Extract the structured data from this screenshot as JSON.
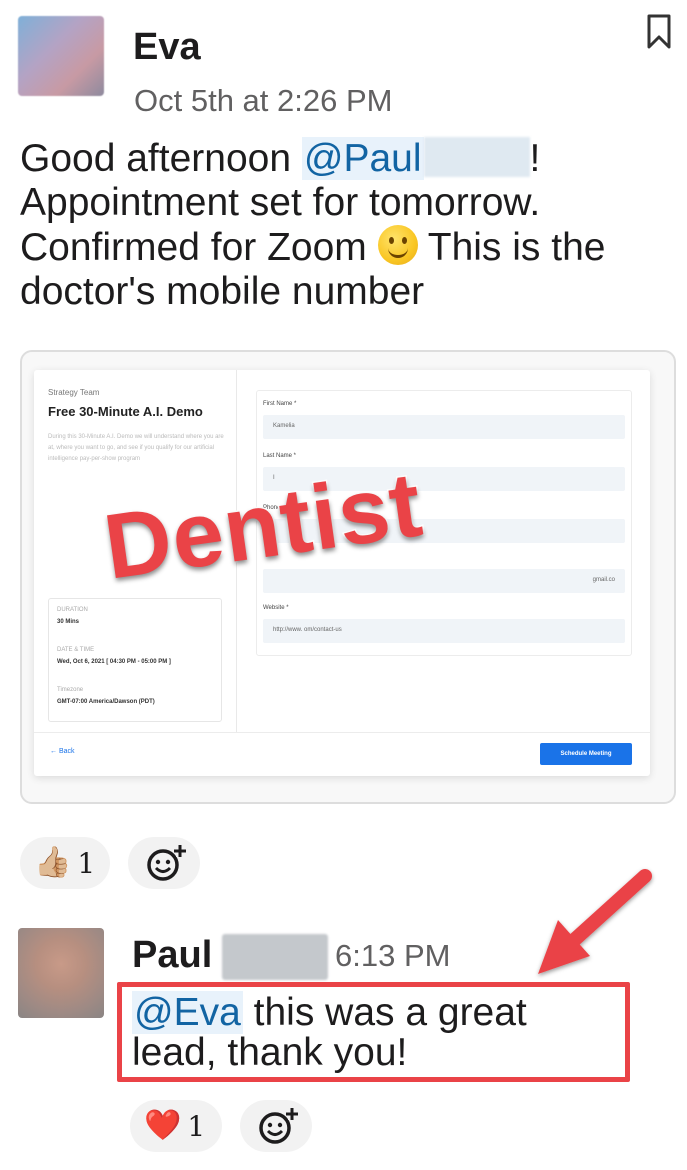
{
  "messages": [
    {
      "author": "Eva",
      "timestamp": "Oct 5th at 2:26 PM",
      "text_intro": "Good afternoon ",
      "mention": "@Paul",
      "text_after_mention": "!",
      "text_body": "Appointment set for tomorrow. Confirmed for Zoom",
      "text_tail": " This is the doctor's mobile number",
      "emoji": "slightly-smiling-face",
      "attachment": {
        "team": "Strategy Team",
        "title": "Free 30-Minute A.I. Demo",
        "description": "During this 30-Minute A.I. Demo we will understand where you are at, where you want to go, and see if you qualify for our artificial intelligence pay-per-show program",
        "duration_label": "DURATION",
        "duration_value": "30 Mins",
        "datetime_label": "DATE & TIME",
        "datetime_value": "Wed, Oct 6, 2021 [ 04:30 PM - 05:00 PM ]",
        "timezone_label": "Timezone",
        "timezone_value": "GMT-07:00 America/Dawson (PDT)",
        "form": {
          "first_name_label": "First Name *",
          "first_name_value": "Kamelia",
          "last_name_label": "Last Name *",
          "last_name_value": "I",
          "phone_label": "Phone *",
          "email_value": "gmail.co",
          "website_label": "Website *",
          "website_value": "http://www.                     om/contact-us"
        },
        "back_label": "← Back",
        "button_label": "Schedule Meeting",
        "overlay_stamp": "Dentist"
      },
      "reactions": [
        {
          "emoji": "👍🏼",
          "count": "1"
        }
      ]
    },
    {
      "author": "Paul",
      "timestamp": "6:13 PM",
      "mention": "@Eva",
      "text": " this was a great lead, thank you!",
      "reactions": [
        {
          "emoji": "❤️",
          "count": "1"
        }
      ]
    }
  ],
  "icons": {
    "bookmark": "bookmark-icon",
    "add_reaction": "add-reaction-icon"
  },
  "colors": {
    "mention": "#1264a3",
    "mention_bg": "#e8f2fb",
    "annotation_red": "#ea4347",
    "timestamp": "#616061"
  }
}
